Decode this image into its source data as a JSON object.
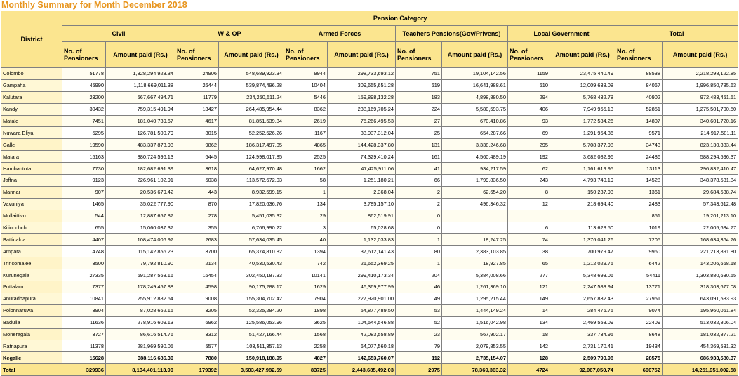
{
  "title": "Monthly Summary for Month December 2018",
  "header": {
    "district": "District",
    "category": "Pension Category",
    "groups": [
      "Civil",
      "W & OP",
      "Armed Forces",
      "Teachers Pensions(Gov/Privens)",
      "Local Government",
      "Total"
    ],
    "no_label": "No. of Pensioners",
    "amt_label": "Amount paid (Rs.)"
  },
  "rows": [
    [
      "Colombo",
      "51778",
      "1,328,294,923.34",
      "24906",
      "548,689,923.34",
      "9944",
      "298,733,693.12",
      "751",
      "19,104,142.56",
      "1159",
      "23,475,440.49",
      "88538",
      "2,218,298,122.85"
    ],
    [
      "Gampaha",
      "45990",
      "1,118,669,011.38",
      "26444",
      "539,874,496.28",
      "10404",
      "309,655,651.28",
      "619",
      "16,641,988.61",
      "610",
      "12,009,638.08",
      "84067",
      "1,996,850,785.63"
    ],
    [
      "Kalutara",
      "23200",
      "567,667,494.71",
      "11779",
      "234,250,511.24",
      "5446",
      "159,898,132.28",
      "183",
      "4,898,880.50",
      "294",
      "5,768,432.78",
      "40902",
      "972,483,451.51"
    ],
    [
      "Kandy",
      "30432",
      "759,315,491.94",
      "13427",
      "264,485,954.44",
      "8362",
      "238,169,705.24",
      "224",
      "5,580,593.75",
      "406",
      "7,949,955.13",
      "52851",
      "1,275,501,700.50"
    ],
    [
      "Matale",
      "7451",
      "181,040,739.67",
      "4617",
      "81,851,539.84",
      "2619",
      "75,266,495.53",
      "27",
      "670,410.86",
      "93",
      "1,772,534.26",
      "14807",
      "340,601,720.16"
    ],
    [
      "Nuwara Eliya",
      "5295",
      "126,781,500.79",
      "3015",
      "52,252,526.26",
      "1167",
      "33,937,312.04",
      "25",
      "654,287.66",
      "69",
      "1,291,954.36",
      "9571",
      "214,917,581.11"
    ],
    [
      "Galle",
      "19590",
      "483,337,873.93",
      "9862",
      "186,317,497.05",
      "4865",
      "144,428,337.80",
      "131",
      "3,338,246.68",
      "295",
      "5,708,377.98",
      "34743",
      "823,130,333.44"
    ],
    [
      "Matara",
      "15163",
      "380,724,596.13",
      "6445",
      "124,998,017.85",
      "2525",
      "74,329,410.24",
      "161",
      "4,560,489.19",
      "192",
      "3,682,082.96",
      "24486",
      "588,294,596.37"
    ],
    [
      "Hambantota",
      "7730",
      "182,682,691.39",
      "3618",
      "64,627,970.48",
      "1662",
      "47,425,911.06",
      "41",
      "934,217.59",
      "62",
      "1,161,619.95",
      "13113",
      "296,832,410.47"
    ],
    [
      "Jaffna",
      "9123",
      "226,961,102.91",
      "5038",
      "113,572,672.03",
      "58",
      "1,251,180.21",
      "66",
      "1,799,836.50",
      "243",
      "4,793,740.19",
      "14528",
      "348,378,531.84"
    ],
    [
      "Mannar",
      "907",
      "20,536,679.42",
      "443",
      "8,932,599.15",
      "1",
      "2,368.04",
      "2",
      "62,654.20",
      "8",
      "150,237.93",
      "1361",
      "29,684,538.74"
    ],
    [
      "Vavuniya",
      "1465",
      "35,022,777.90",
      "870",
      "17,820,636.76",
      "134",
      "3,785,157.10",
      "2",
      "496,346.32",
      "12",
      "218,694.40",
      "2483",
      "57,343,612.48"
    ],
    [
      "Mullaittivu",
      "544",
      "12,887,657.87",
      "278",
      "5,451,035.32",
      "29",
      "862,519.91",
      "0",
      "",
      "",
      "",
      "851",
      "19,201,213.10"
    ],
    [
      "Kilinochchi",
      "655",
      "15,060,037.37",
      "355",
      "6,766,990.22",
      "3",
      "65,028.68",
      "0",
      "",
      "6",
      "113,628.50",
      "1019",
      "22,005,684.77"
    ],
    [
      "Batticaloa",
      "4407",
      "108,474,006.97",
      "2683",
      "57,634,035.45",
      "40",
      "1,132,033.83",
      "1",
      "18,247.25",
      "74",
      "1,376,041.26",
      "7205",
      "168,634,364.76"
    ],
    [
      "Ampara",
      "4748",
      "115,142,856.23",
      "3700",
      "65,374,810.82",
      "1394",
      "37,612,141.43",
      "80",
      "2,383,103.85",
      "38",
      "700,979.47",
      "9960",
      "221,213,891.80"
    ],
    [
      "Trincomalee",
      "3500",
      "79,792,810.90",
      "2134",
      "40,530,530.43",
      "742",
      "21,652,369.25",
      "1",
      "18,927.85",
      "65",
      "1,212,029.75",
      "6442",
      "143,206,668.18"
    ],
    [
      "Kurunegala",
      "27335",
      "691,287,568.16",
      "16454",
      "302,450,187.33",
      "10141",
      "299,410,173.34",
      "204",
      "5,384,008.66",
      "277",
      "5,348,693.06",
      "54411",
      "1,303,880,630.55"
    ],
    [
      "Puttalam",
      "7377",
      "178,249,457.88",
      "4598",
      "90,175,288.17",
      "1629",
      "46,369,977.99",
      "46",
      "1,261,369.10",
      "121",
      "2,247,583.94",
      "13771",
      "318,303,677.08"
    ],
    [
      "Anuradhapura",
      "10841",
      "255,912,882.64",
      "9008",
      "155,304,702.42",
      "7904",
      "227,920,901.00",
      "49",
      "1,295,215.44",
      "149",
      "2,657,832.43",
      "27951",
      "643,091,533.93"
    ],
    [
      "Polonnaruwa",
      "3904",
      "87,028,662.15",
      "3205",
      "52,325,284.20",
      "1898",
      "54,877,489.50",
      "53",
      "1,444,149.24",
      "14",
      "284,476.75",
      "9074",
      "195,960,061.84"
    ],
    [
      "Badulla",
      "11636",
      "278,916,609.13",
      "6962",
      "125,586,053.96",
      "3625",
      "104,544,546.88",
      "52",
      "1,516,042.98",
      "134",
      "2,469,553.09",
      "22409",
      "513,032,806.04"
    ],
    [
      "Moneragala",
      "3727",
      "86,616,514.76",
      "3312",
      "51,427,166.44",
      "1568",
      "42,083,558.89",
      "23",
      "567,902.17",
      "18",
      "337,734.95",
      "8648",
      "181,032,877.21"
    ],
    [
      "Ratnapura",
      "11378",
      "281,969,590.05",
      "5577",
      "103,511,357.13",
      "2258",
      "64,077,560.18",
      "79",
      "2,079,853.55",
      "142",
      "2,731,170.41",
      "19434",
      "454,369,531.32"
    ],
    [
      "Kegalle",
      "15628",
      "388,116,686.30",
      "7880",
      "150,918,188.95",
      "4827",
      "142,653,760.07",
      "112",
      "2,735,154.07",
      "128",
      "2,509,790.98",
      "28575",
      "686,933,580.37"
    ]
  ],
  "total": [
    "Total",
    "329936",
    "8,134,401,113.90",
    "179392",
    "3,503,427,982.59",
    "83725",
    "2,443,685,492.03",
    "2975",
    "78,369,363.32",
    "4724",
    "92,067,050.74",
    "600752",
    "14,251,951,002.58"
  ]
}
